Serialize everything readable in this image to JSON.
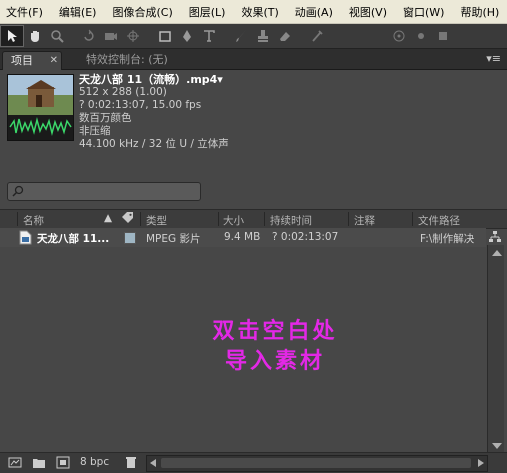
{
  "menubar": {
    "items": [
      "文件(F)",
      "编辑(E)",
      "图像合成(C)",
      "图层(L)",
      "效果(T)",
      "动画(A)",
      "视图(V)",
      "窗口(W)",
      "帮助(H)"
    ]
  },
  "toolbar": {
    "tools": [
      "selection-tool",
      "hand-tool",
      "zoom-tool",
      "rotate-tool",
      "camera-tool",
      "pan-behind-tool",
      "mask-tool",
      "pen-tool",
      "type-tool",
      "brush-tool",
      "clone-stamp-tool",
      "eraser-tool",
      "puppet-tool",
      "axis-tool"
    ]
  },
  "tabs": {
    "project": "项目",
    "effect_controls": "特效控制台: (无)"
  },
  "footage_info": {
    "name": "天龙八部 11（流畅）.mp4▾",
    "dimensions": "512 x 288 (1.00)",
    "duration": "? 0:02:13:07, 15.00 fps",
    "colors": "数百万颜色",
    "compression": "非压缩",
    "audio": "44.100 kHz / 32 位 U / 立体声"
  },
  "list": {
    "headers": {
      "name": "名称",
      "type": "类型",
      "size": "大小",
      "duration": "持续时间",
      "comment": "注释",
      "path": "文件路径"
    },
    "rows": [
      {
        "name": "天龙八部 11...",
        "type": "MPEG 影片",
        "size": "9.4 MB",
        "duration": "? 0:02:13:07",
        "path": "F:\\制作解决"
      }
    ]
  },
  "overlay": {
    "line1": "双击空白处",
    "line2": "导入素材"
  },
  "bottom": {
    "bit_depth": "8 bpc"
  },
  "colors": {
    "panel_bg": "#474747",
    "overlay_text": "#e328e6",
    "label_swatch": "#9fb6c4"
  }
}
